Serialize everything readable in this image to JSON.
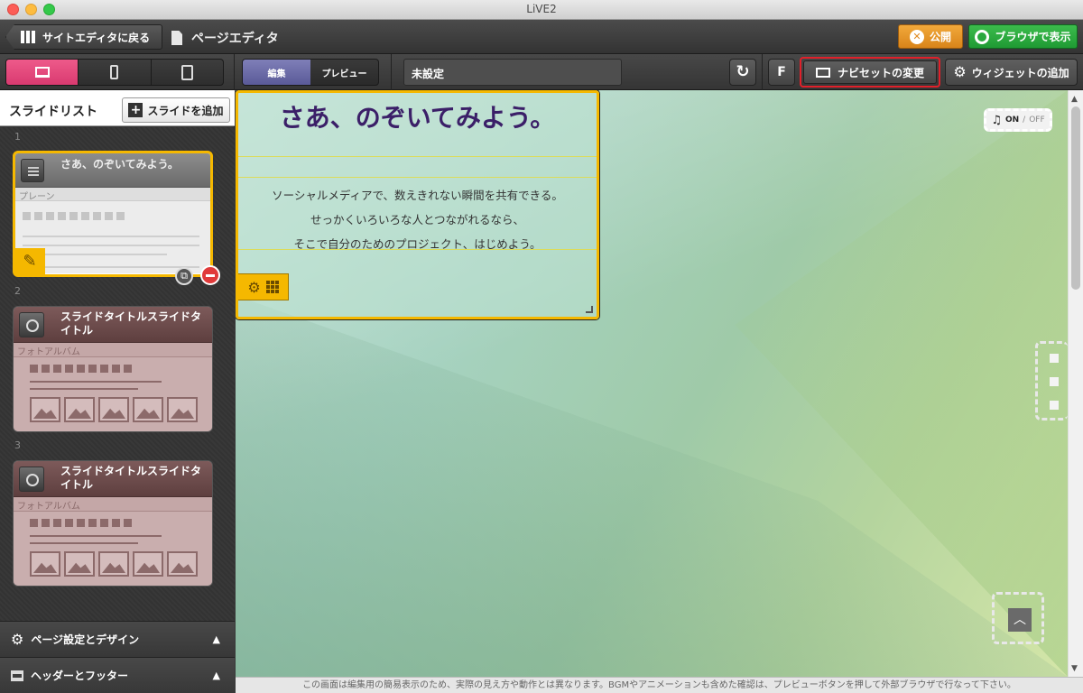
{
  "window": {
    "title": "LiVE2"
  },
  "topbar": {
    "back_label": "サイトエディタに戻る",
    "page_label": "ページエディタ",
    "publish_label": "公開",
    "browser_label": "ブラウザで表示"
  },
  "toolbar": {
    "mode_edit": "編集",
    "mode_preview": "プレビュー",
    "field_value": "未設定",
    "f_label": "F",
    "naviset_label": "ナビセットの変更",
    "widget_label": "ウィジェットの追加"
  },
  "sidebar": {
    "title": "スライドリスト",
    "add_label": "スライドを追加",
    "slides": [
      {
        "num": "1",
        "title": "さあ、のぞいてみよう。",
        "type": "プレーン"
      },
      {
        "num": "2",
        "title": "スライドタイトルスライドタイトル",
        "type": "フォトアルバム"
      },
      {
        "num": "3",
        "title": "スライドタイトルスライドタイトル",
        "type": "フォトアルバム"
      }
    ],
    "accordion_page": "ページ設定とデザイン",
    "accordion_hf": "ヘッダーとフッター"
  },
  "canvas": {
    "title": "さあ、のぞいてみよう。",
    "line1": "ソーシャルメディアで、数えきれない瞬間を共有できる。",
    "line2": "せっかくいろいろな人とつながれるなら、",
    "line3": "そこで自分のためのプロジェクト、はじめよう。",
    "music_on": "ON",
    "music_sep": " / ",
    "music_off": "OFF"
  },
  "footer": {
    "note": "この画面は編集用の簡易表示のため、実際の見え方や動作とは異なります。BGMやアニメーションも含めた確認は、プレビューボタンを押して外部ブラウザで行なって下さい。"
  },
  "colors": {
    "accent_pink": "#e84a80",
    "publish_orange": "#e89426",
    "browser_green": "#2aab3e",
    "slide_highlight": "#f5b800",
    "title_purple": "#3b1f68",
    "naviset_outline": "#e0202a"
  }
}
